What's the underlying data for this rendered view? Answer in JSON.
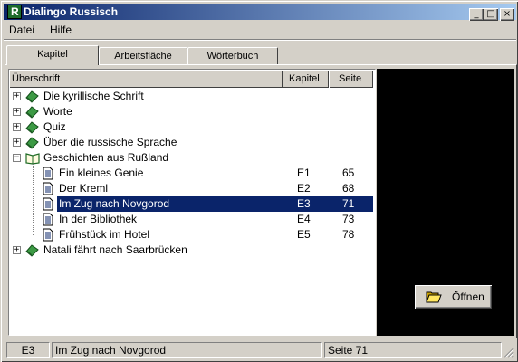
{
  "window": {
    "title": "Dialingo Russisch",
    "icon_letter": "R"
  },
  "caption_buttons": {
    "minimize": "_",
    "maximize": "□",
    "close": "×"
  },
  "menu": [
    {
      "label": "Datei"
    },
    {
      "label": "Hilfe"
    }
  ],
  "tabs": [
    {
      "label": "Kapitel",
      "active": true
    },
    {
      "label": "Arbeitsfläche",
      "active": false
    },
    {
      "label": "Wörterbuch",
      "active": false
    }
  ],
  "columns": {
    "heading": "Überschrift",
    "chapter": "Kapitel",
    "page": "Seite"
  },
  "tree": [
    {
      "label": "Die kyrillische Schrift",
      "type": "book",
      "expanded": false
    },
    {
      "label": "Worte",
      "type": "book",
      "expanded": false
    },
    {
      "label": "Quiz",
      "type": "book",
      "expanded": false
    },
    {
      "label": "Über die russische Sprache",
      "type": "book",
      "expanded": false
    },
    {
      "label": "Geschichten aus Rußland",
      "type": "open-book",
      "expanded": true
    },
    {
      "label": "Ein kleines Genie",
      "type": "page",
      "chapter": "E1",
      "page": "65"
    },
    {
      "label": "Der Kreml",
      "type": "page",
      "chapter": "E2",
      "page": "68"
    },
    {
      "label": "Im Zug nach Novgorod",
      "type": "page",
      "chapter": "E3",
      "page": "71",
      "selected": true
    },
    {
      "label": "In der Bibliothek",
      "type": "page",
      "chapter": "E4",
      "page": "73"
    },
    {
      "label": "Frühstück im Hotel",
      "type": "page",
      "chapter": "E5",
      "page": "78"
    },
    {
      "label": "Natali fährt nach Saarbrücken",
      "type": "book",
      "expanded": false
    }
  ],
  "open_button": {
    "label": "Öffnen",
    "icon": "open-folder-icon"
  },
  "status": {
    "chapter": "E3",
    "title": "Im Zug nach Novgorod",
    "page": "Seite 71"
  },
  "colors": {
    "titlebar_start": "#0a246a",
    "titlebar_end": "#a6caf0",
    "selection": "#0a246a",
    "book_green": "#2f8a3a"
  }
}
